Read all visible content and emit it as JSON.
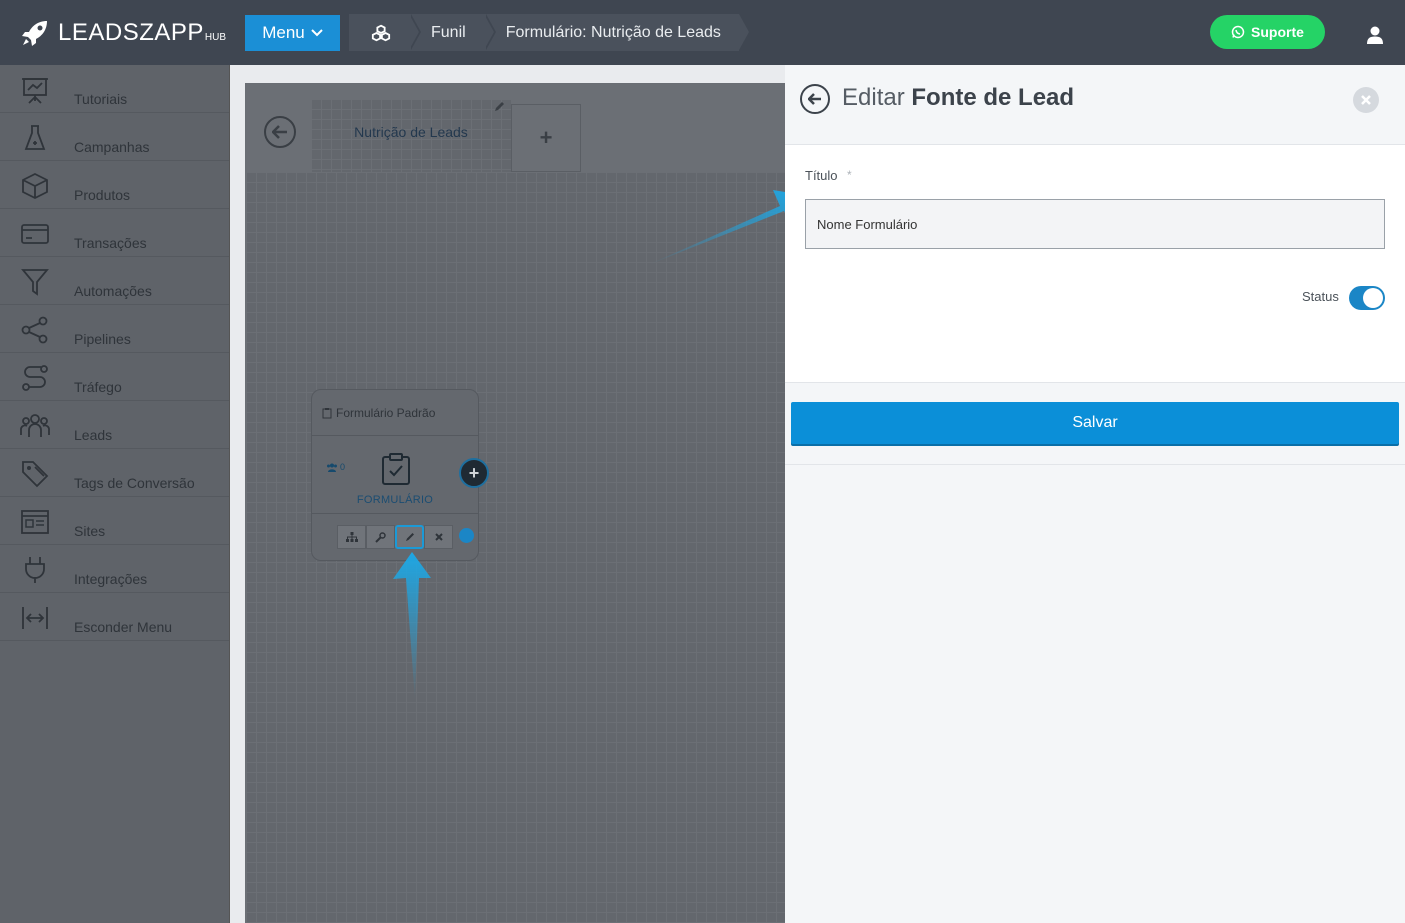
{
  "brand": {
    "name": "LEADSZAPP",
    "suffix": "HUB"
  },
  "header": {
    "menu_label": "Menu",
    "breadcrumbs": [
      "Funil",
      "Formulário: Nutrição de Leads"
    ],
    "support_label": "Suporte"
  },
  "sidebar": {
    "items": [
      {
        "label": "Tutoriais",
        "icon": "presentation-icon"
      },
      {
        "label": "Campanhas",
        "icon": "flask-icon"
      },
      {
        "label": "Produtos",
        "icon": "box-icon"
      },
      {
        "label": "Transações",
        "icon": "credit-card-icon"
      },
      {
        "label": "Automações",
        "icon": "filter-icon"
      },
      {
        "label": "Pipelines",
        "icon": "share-icon"
      },
      {
        "label": "Tráfego",
        "icon": "route-icon"
      },
      {
        "label": "Leads",
        "icon": "users-icon"
      },
      {
        "label": "Tags de Conversão",
        "icon": "tags-icon"
      },
      {
        "label": "Sites",
        "icon": "browser-icon"
      },
      {
        "label": "Integrações",
        "icon": "plug-icon"
      },
      {
        "label": "Esconder Menu",
        "icon": "collapse-arrows-icon"
      }
    ]
  },
  "canvas": {
    "tab_label": "Nutrição de Leads",
    "add_tab_label": "+",
    "node": {
      "title": "Formulário Padrão",
      "lead_count": "0",
      "type_label": "FORMULÁRIO"
    }
  },
  "panel": {
    "title_light": "Editar",
    "title_bold": "Fonte de Lead",
    "field_label": "Título",
    "field_required": "*",
    "field_value": "Nome Formulário",
    "status_label": "Status",
    "status_on": true,
    "save_label": "Salvar"
  },
  "colors": {
    "topbar": "#3f4651",
    "primary": "#0b8fd8",
    "whatsapp": "#25d366",
    "annotation_arrow": "#1ea7e4"
  }
}
